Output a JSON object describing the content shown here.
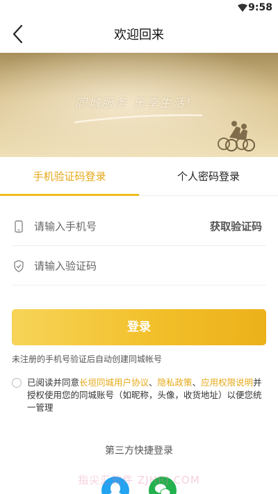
{
  "status_bar": {
    "time": "9:58",
    "wifi_icon": "wifi-icon"
  },
  "nav": {
    "back_icon": "back-arrow-icon",
    "title": "欢迎回来"
  },
  "banner": {
    "slogan": "同城服务  乐享生活!"
  },
  "tabs": [
    {
      "label": "手机验证码登录",
      "active": true
    },
    {
      "label": "个人密码登录",
      "active": false
    }
  ],
  "form": {
    "phone": {
      "placeholder": "请输入手机号",
      "value": "",
      "icon": "phone-icon"
    },
    "get_code_label": "获取验证码",
    "code": {
      "placeholder": "请输入验证码",
      "value": "",
      "icon": "shield-check-icon"
    },
    "login_label": "登录"
  },
  "hint": "未注册的手机号验证后自动创建同城帐号",
  "agreement": {
    "checked": false,
    "prefix": "已阅读并同意",
    "link_user_agreement": "长垣同城用户协议",
    "sep1": "、",
    "link_privacy": "隐私政策",
    "sep2": "、",
    "link_permission": "应用权限说明",
    "suffix": "并授权使用您的同城账号（如昵称，头像，收货地址）以便您统一管理"
  },
  "third_party": {
    "title": "第三方快捷登录",
    "providers": [
      {
        "name": "QQ",
        "icon": "qq-icon"
      },
      {
        "name": "WeChat",
        "icon": "wechat-icon"
      }
    ]
  },
  "watermark": "指尖汇软件  ZJHRJ.COM",
  "colors": {
    "accent": "#f0bb1e",
    "accent_text": "#e6a817",
    "qq": "#23a3f0",
    "wechat": "#22b14c"
  }
}
